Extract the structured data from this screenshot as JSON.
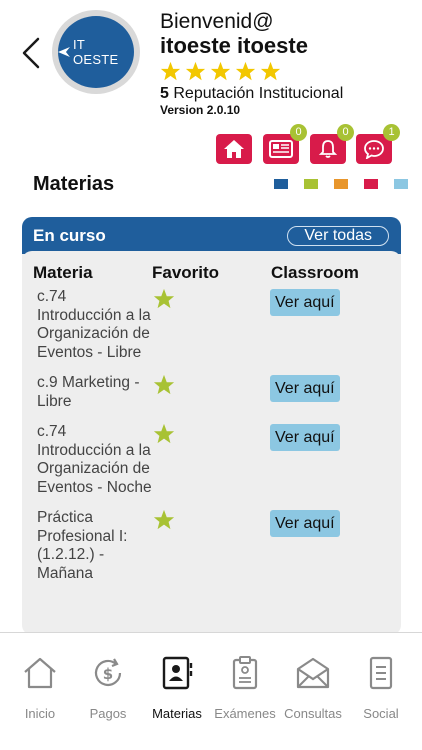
{
  "header": {
    "greeting": "Bienvenid@",
    "username": "itoeste itoeste",
    "rating_stars": 5,
    "reputation_value": "5",
    "reputation_label": "Reputación Institucional",
    "version": "Version 2.0.10",
    "logo_text": "IT OESTE",
    "star_color": "#f2c700"
  },
  "quick_actions": [
    {
      "icon": "home-icon",
      "badge": null
    },
    {
      "icon": "news-icon",
      "badge": "0"
    },
    {
      "icon": "bell-icon",
      "badge": "0"
    },
    {
      "icon": "chat-icon",
      "badge": "1"
    }
  ],
  "section": {
    "title": "Materias",
    "swatches": [
      "#1f5e9c",
      "#a8c234",
      "#e8962c",
      "#d81b4a",
      "#8cc7e2"
    ]
  },
  "card": {
    "title": "En curso",
    "see_all": "Ver todas",
    "columns": [
      "Materia",
      "Favorito",
      "Classroom"
    ],
    "rows": [
      {
        "name": "c.74 Introducción a la Organización de Eventos - Libre",
        "favorite": true,
        "link": "Ver aquí"
      },
      {
        "name": "c.9 Marketing - Libre",
        "favorite": true,
        "link": "Ver aquí"
      },
      {
        "name": "c.74 Introducción a la Organización de Eventos - Noche",
        "favorite": true,
        "link": "Ver aquí"
      },
      {
        "name": "Práctica Profesional I: (1.2.12.) - Mañana",
        "favorite": true,
        "link": "Ver aquí"
      }
    ]
  },
  "tabbar": {
    "tabs": [
      {
        "label": "Inicio",
        "icon": "home-outline-icon"
      },
      {
        "label": "Pagos",
        "icon": "payments-icon"
      },
      {
        "label": "Materias",
        "icon": "contacts-book-icon",
        "active": true
      },
      {
        "label": "Exámenes",
        "icon": "clipboard-icon"
      },
      {
        "label": "Consultas",
        "icon": "envelope-icon"
      },
      {
        "label": "Social",
        "icon": "document-icon"
      }
    ]
  },
  "colors": {
    "accent": "#d81b4a",
    "primary": "#1f5e9c",
    "badge": "#a8c234",
    "link_button": "#8cc7e2"
  }
}
